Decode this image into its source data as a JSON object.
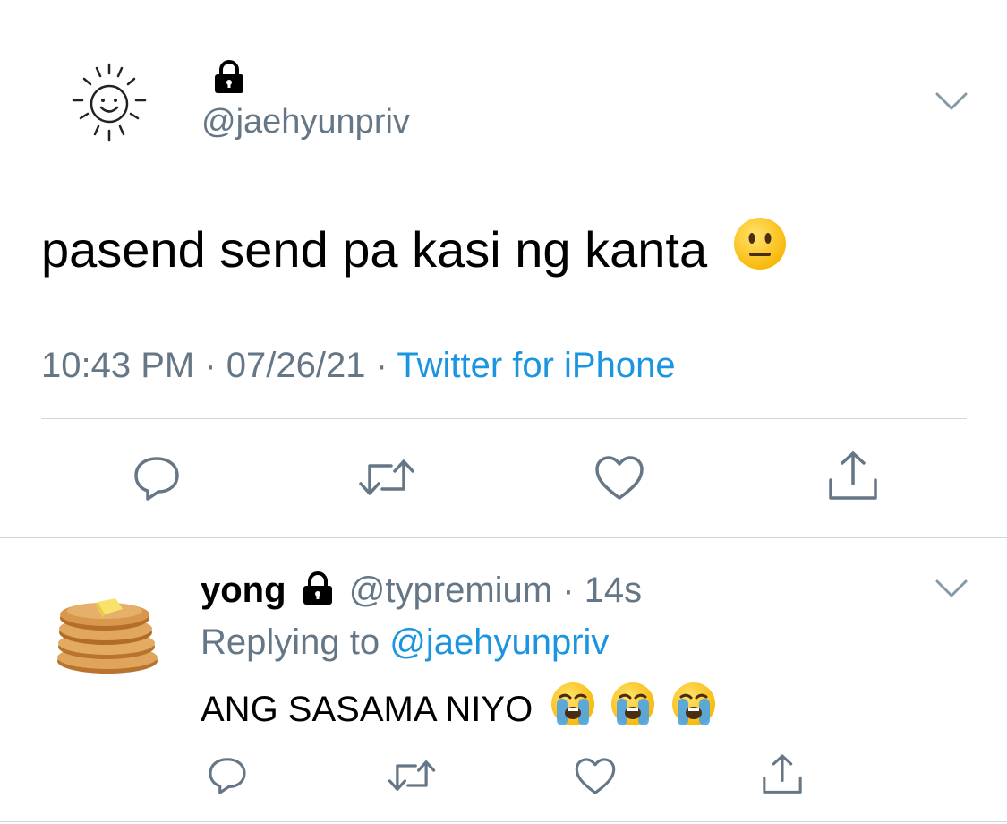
{
  "tweet": {
    "handle": "@jaehyunpriv",
    "text": "pasend send pa kasi ng kanta",
    "time": "10:43 PM",
    "sep1": "·",
    "date": "07/26/21",
    "sep2": "·",
    "source": "Twitter for iPhone",
    "text_emoji": "neutral-face-emoji"
  },
  "reply": {
    "name": "yong",
    "handle": "@typremium",
    "dot": "·",
    "age": "14s",
    "replying_prefix": "Replying to",
    "replying_to": "@jaehyunpriv",
    "text": "ANG SASAMA NIYO",
    "text_emojis": [
      "loudly-crying-face-emoji",
      "loudly-crying-face-emoji",
      "loudly-crying-face-emoji"
    ]
  },
  "colors": {
    "link_blue": "#1b95e0",
    "meta_gray": "#657786",
    "icon_gray": "#657786",
    "divider": "#cfd6dc"
  },
  "icons": {
    "reply": "reply-icon",
    "retweet": "retweet-icon",
    "like": "heart-icon",
    "share": "share-icon",
    "more": "chevron-down-icon",
    "protected": "lock-icon"
  }
}
